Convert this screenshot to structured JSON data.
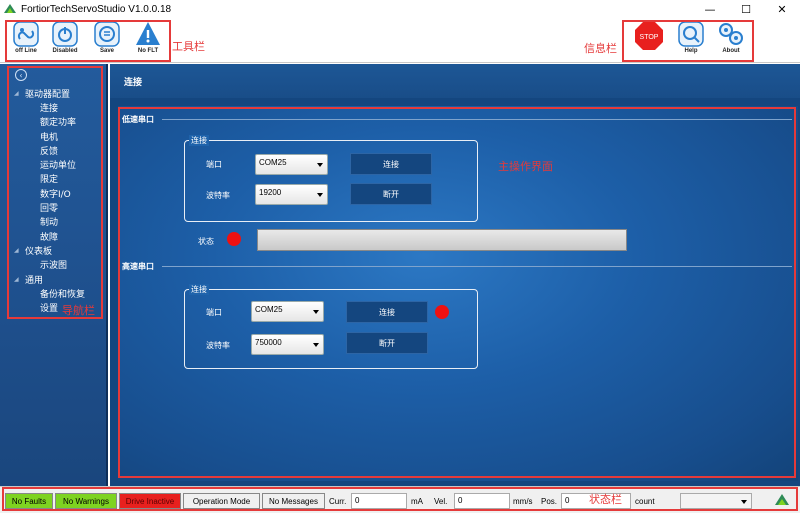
{
  "app": {
    "title": "FortiorTechServoStudio V1.0.0.18"
  },
  "window_controls": {
    "minimize": "—",
    "maximize": "☐",
    "close": "✕"
  },
  "toolbar": {
    "offline_label": "off Line",
    "disabled_label": "Disabled",
    "save_label": "Save",
    "nofl_label": "No FLT",
    "stop_label": "STOP",
    "help_label": "Help",
    "about_label": "About"
  },
  "annotations": {
    "toolbar": "工具栏",
    "info_bar": "信息栏",
    "main_area": "主操作界面",
    "nav_bar": "导航栏",
    "status_bar": "状态栏"
  },
  "sidebar": {
    "items": [
      {
        "label": "驱动器配置",
        "type": "group"
      },
      {
        "label": "连接",
        "type": "child"
      },
      {
        "label": "额定功率",
        "type": "child"
      },
      {
        "label": "电机",
        "type": "child"
      },
      {
        "label": "反馈",
        "type": "child"
      },
      {
        "label": "运动单位",
        "type": "child"
      },
      {
        "label": "限定",
        "type": "child"
      },
      {
        "label": "数字I/O",
        "type": "child"
      },
      {
        "label": "回零",
        "type": "child"
      },
      {
        "label": "制动",
        "type": "child"
      },
      {
        "label": "故障",
        "type": "child"
      },
      {
        "label": "仪表板",
        "type": "group"
      },
      {
        "label": "示波图",
        "type": "child"
      },
      {
        "label": "通用",
        "type": "group"
      },
      {
        "label": "备份和恢复",
        "type": "child"
      },
      {
        "label": "设置",
        "type": "child"
      }
    ]
  },
  "main": {
    "breadcrumb": "连接",
    "low_speed": {
      "section_title": "低速串口",
      "group_title": "连接",
      "port_label": "端口",
      "port_value": "COM25",
      "baud_label": "波特率",
      "baud_value": "19200",
      "connect_button": "连接",
      "disconnect_button": "断开",
      "status_label": "状态"
    },
    "high_speed": {
      "section_title": "高速串口",
      "group_title": "连接",
      "port_label": "端口",
      "port_value": "COM25",
      "baud_label": "波特率",
      "baud_value": "750000",
      "connect_button": "连接",
      "disconnect_button": "断开"
    }
  },
  "statusbar": {
    "no_faults": "No Faults",
    "no_warnings": "No Warnings",
    "drive_inactive": "Drive Inactive",
    "operation_mode": "Operation Mode",
    "no_messages": "No Messages",
    "curr_label": "Curr.",
    "curr_value": "0",
    "curr_unit": "mA",
    "vel_label": "Vel.",
    "vel_value": "0",
    "vel_unit": "mm/s",
    "pos_label": "Pos.",
    "pos_value": "0",
    "pos_unit": "count",
    "unit_select": ""
  },
  "colors": {
    "annotation_red": "#e53a3a",
    "ok_green": "#7ed321",
    "inactive_red": "#e8201e",
    "sidebar_blue": "#1e4f8c",
    "status_led": "#ee1111"
  }
}
